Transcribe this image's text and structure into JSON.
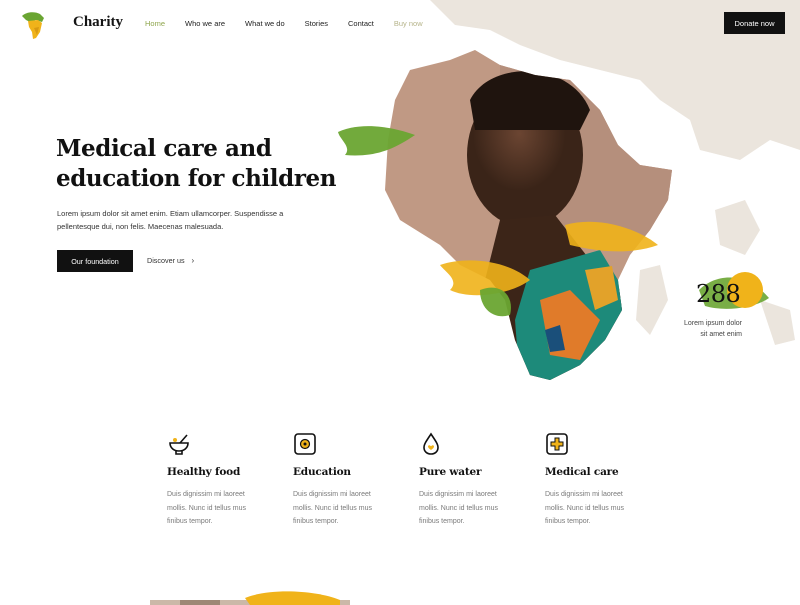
{
  "header": {
    "brand": "Charity",
    "nav": [
      "Home",
      "Who we are",
      "What we do",
      "Stories",
      "Contact",
      "Buy now"
    ],
    "donate_label": "Donate now"
  },
  "hero": {
    "title_line1": "Medical care and",
    "title_line2": "education for children",
    "text": "Lorem ipsum dolor sit amet enim. Etiam ullamcorper. Suspendisse a pellentesque dui, non felis. Maecenas malesuada.",
    "primary_label": "Our foundation",
    "secondary_label": "Discover us"
  },
  "stat": {
    "value": "288",
    "label_line1": "Lorem ipsum dolor",
    "label_line2": "sit amet enim"
  },
  "features": [
    {
      "title": "Healthy food",
      "icon": "mortar-bowl-icon",
      "text": "Duis dignissim mi laoreet mollis. Nunc id tellus mus finibus tempor."
    },
    {
      "title": "Education",
      "icon": "education-badge-icon",
      "text": "Duis dignissim mi laoreet mollis. Nunc id tellus mus finibus tempor."
    },
    {
      "title": "Pure water",
      "icon": "water-drop-icon",
      "text": "Duis dignissim mi laoreet mollis. Nunc id tellus mus finibus tempor."
    },
    {
      "title": "Medical care",
      "icon": "medical-badge-icon",
      "text": "Duis dignissim mi laoreet mollis. Nunc id tellus mus finibus tempor."
    }
  ],
  "colors": {
    "accent_green": "#8fa64d",
    "accent_yellow": "#f0b31a",
    "brush_green": "#6aa532",
    "map_beige": "#ece6de",
    "dark": "#111111"
  }
}
